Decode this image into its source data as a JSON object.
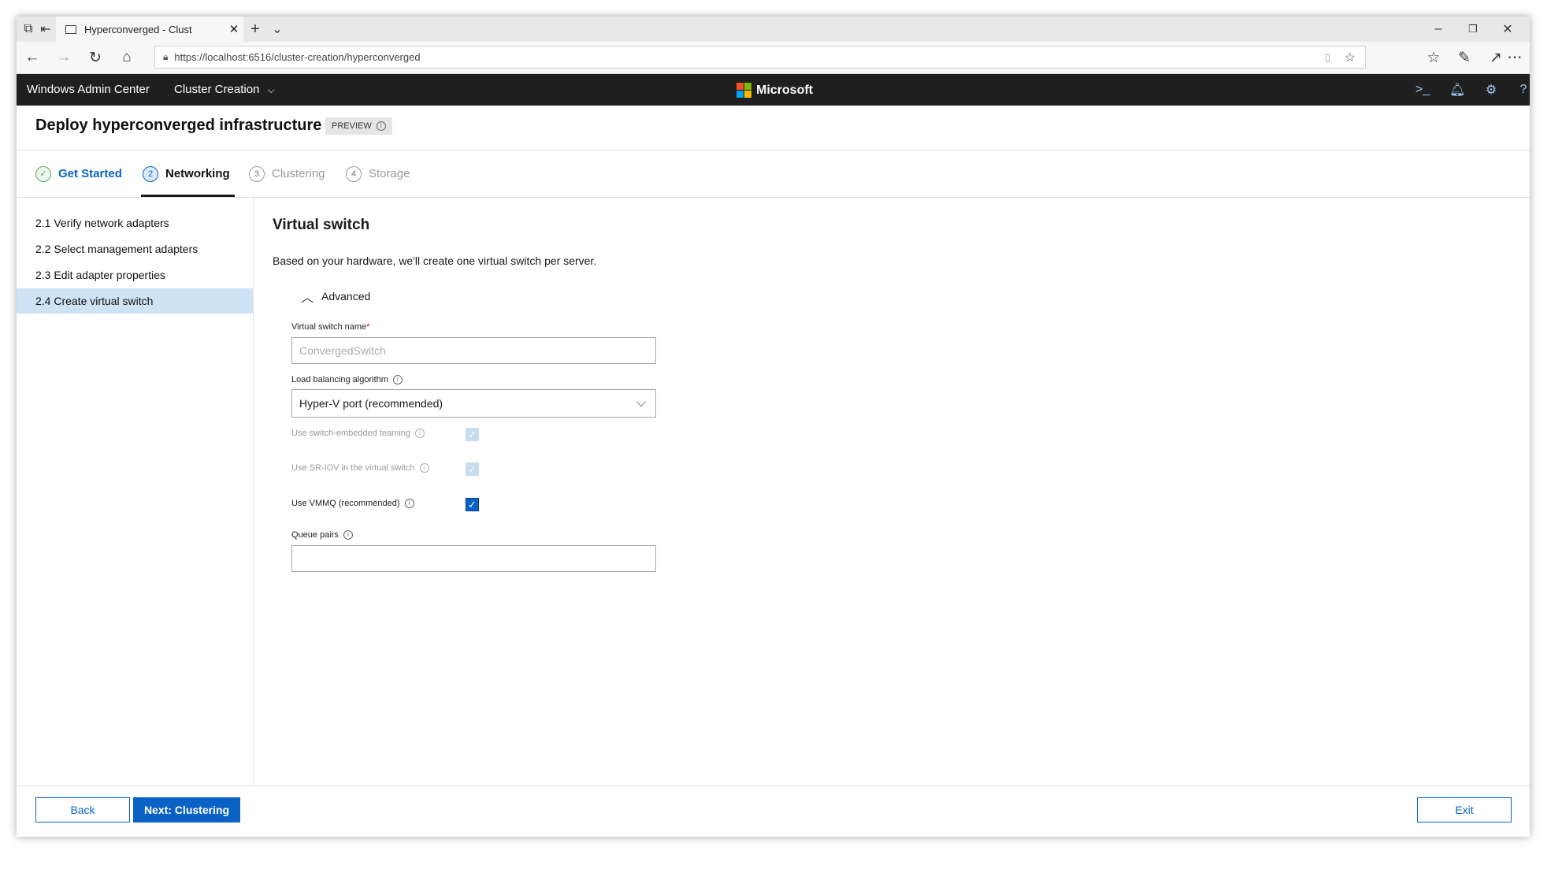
{
  "browser": {
    "tab_title": "Hyperconverged - Clust",
    "url": "https://localhost:6516/cluster-creation/hyperconverged"
  },
  "app": {
    "brand": "Windows Admin Center",
    "context": "Cluster Creation",
    "company": "Microsoft"
  },
  "page": {
    "title": "Deploy hyperconverged infrastructure",
    "badge": "PREVIEW"
  },
  "steps": [
    {
      "num": "✓",
      "label": "Get Started",
      "state": "done"
    },
    {
      "num": "2",
      "label": "Networking",
      "state": "active"
    },
    {
      "num": "3",
      "label": "Clustering",
      "state": "pending"
    },
    {
      "num": "4",
      "label": "Storage",
      "state": "pending"
    }
  ],
  "sidebar": {
    "items": [
      {
        "label": "2.1  Verify network adapters"
      },
      {
        "label": "2.2  Select management adapters"
      },
      {
        "label": "2.3  Edit adapter properties"
      },
      {
        "label": "2.4  Create virtual switch"
      }
    ]
  },
  "content": {
    "heading": "Virtual switch",
    "description": "Based on your hardware, we'll create one virtual switch per server.",
    "advanced_label": "Advanced",
    "switch_name_label": "Virtual switch name",
    "switch_name_placeholder": "ConvergedSwitch",
    "lb_label": "Load balancing algorithm",
    "lb_value": "Hyper-V port (recommended)",
    "set_label": "Use switch-embedded teaming",
    "sriov_label": "Use SR-IOV in the virtual switch",
    "vmmq_label": "Use VMMQ (recommended)",
    "queue_label": "Queue pairs",
    "queue_value": ""
  },
  "footer": {
    "back": "Back",
    "next": "Next: Clustering",
    "exit": "Exit"
  },
  "colors": {
    "accent": "#0a63c4",
    "appbar": "#1f1f1f",
    "selected_nav": "#cfe3f7"
  }
}
